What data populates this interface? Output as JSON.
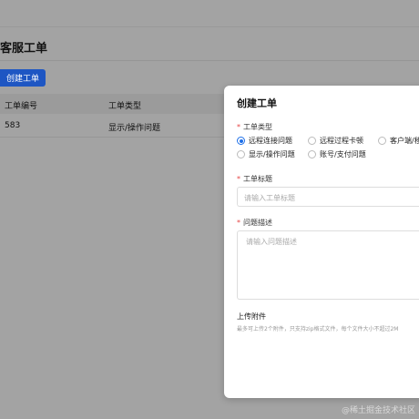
{
  "page": {
    "title": "客服工单",
    "create_button": "创建工单",
    "table": {
      "headers": [
        "工单编号",
        "工单类型"
      ],
      "rows": [
        [
          "583",
          "显示/操作问题"
        ]
      ]
    }
  },
  "modal": {
    "title": "创建工单",
    "type_label": "工单类型",
    "type_options": [
      "远程连接问题",
      "远程过程卡顿",
      "客户端/移",
      "显示/操作问题",
      "账号/支付问题"
    ],
    "type_selected": "远程连接问题",
    "subject_label": "工单标题",
    "subject_placeholder": "请输入工单标题",
    "desc_label": "问题描述",
    "desc_placeholder": "请输入问题描述",
    "upload_label": "上传附件",
    "upload_hint": "最多可上传2个附件，只支持zip格式文件，每个文件大小不超过2M"
  },
  "watermark": "@稀土掘金技术社区",
  "colors": {
    "primary": "#1e6fe8",
    "required": "#e64545",
    "overlay": "#a3a3a3"
  }
}
